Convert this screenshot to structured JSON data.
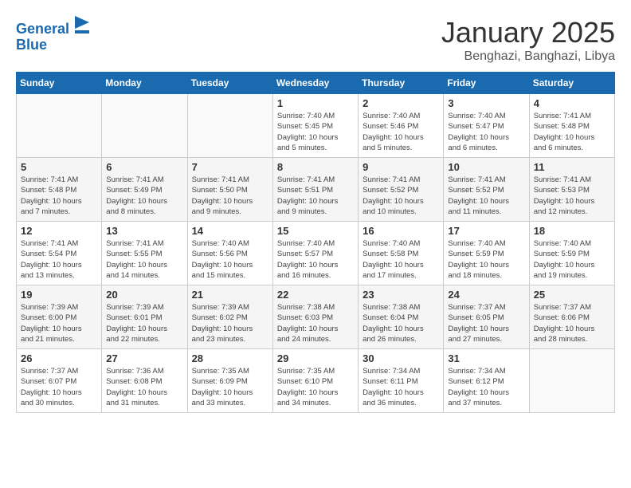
{
  "header": {
    "logo_line1": "General",
    "logo_line2": "Blue",
    "month": "January 2025",
    "location": "Benghazi, Banghazi, Libya"
  },
  "weekdays": [
    "Sunday",
    "Monday",
    "Tuesday",
    "Wednesday",
    "Thursday",
    "Friday",
    "Saturday"
  ],
  "weeks": [
    [
      {
        "day": "",
        "info": ""
      },
      {
        "day": "",
        "info": ""
      },
      {
        "day": "",
        "info": ""
      },
      {
        "day": "1",
        "info": "Sunrise: 7:40 AM\nSunset: 5:45 PM\nDaylight: 10 hours\nand 5 minutes."
      },
      {
        "day": "2",
        "info": "Sunrise: 7:40 AM\nSunset: 5:46 PM\nDaylight: 10 hours\nand 5 minutes."
      },
      {
        "day": "3",
        "info": "Sunrise: 7:40 AM\nSunset: 5:47 PM\nDaylight: 10 hours\nand 6 minutes."
      },
      {
        "day": "4",
        "info": "Sunrise: 7:41 AM\nSunset: 5:48 PM\nDaylight: 10 hours\nand 6 minutes."
      }
    ],
    [
      {
        "day": "5",
        "info": "Sunrise: 7:41 AM\nSunset: 5:48 PM\nDaylight: 10 hours\nand 7 minutes."
      },
      {
        "day": "6",
        "info": "Sunrise: 7:41 AM\nSunset: 5:49 PM\nDaylight: 10 hours\nand 8 minutes."
      },
      {
        "day": "7",
        "info": "Sunrise: 7:41 AM\nSunset: 5:50 PM\nDaylight: 10 hours\nand 9 minutes."
      },
      {
        "day": "8",
        "info": "Sunrise: 7:41 AM\nSunset: 5:51 PM\nDaylight: 10 hours\nand 9 minutes."
      },
      {
        "day": "9",
        "info": "Sunrise: 7:41 AM\nSunset: 5:52 PM\nDaylight: 10 hours\nand 10 minutes."
      },
      {
        "day": "10",
        "info": "Sunrise: 7:41 AM\nSunset: 5:52 PM\nDaylight: 10 hours\nand 11 minutes."
      },
      {
        "day": "11",
        "info": "Sunrise: 7:41 AM\nSunset: 5:53 PM\nDaylight: 10 hours\nand 12 minutes."
      }
    ],
    [
      {
        "day": "12",
        "info": "Sunrise: 7:41 AM\nSunset: 5:54 PM\nDaylight: 10 hours\nand 13 minutes."
      },
      {
        "day": "13",
        "info": "Sunrise: 7:41 AM\nSunset: 5:55 PM\nDaylight: 10 hours\nand 14 minutes."
      },
      {
        "day": "14",
        "info": "Sunrise: 7:40 AM\nSunset: 5:56 PM\nDaylight: 10 hours\nand 15 minutes."
      },
      {
        "day": "15",
        "info": "Sunrise: 7:40 AM\nSunset: 5:57 PM\nDaylight: 10 hours\nand 16 minutes."
      },
      {
        "day": "16",
        "info": "Sunrise: 7:40 AM\nSunset: 5:58 PM\nDaylight: 10 hours\nand 17 minutes."
      },
      {
        "day": "17",
        "info": "Sunrise: 7:40 AM\nSunset: 5:59 PM\nDaylight: 10 hours\nand 18 minutes."
      },
      {
        "day": "18",
        "info": "Sunrise: 7:40 AM\nSunset: 5:59 PM\nDaylight: 10 hours\nand 19 minutes."
      }
    ],
    [
      {
        "day": "19",
        "info": "Sunrise: 7:39 AM\nSunset: 6:00 PM\nDaylight: 10 hours\nand 21 minutes."
      },
      {
        "day": "20",
        "info": "Sunrise: 7:39 AM\nSunset: 6:01 PM\nDaylight: 10 hours\nand 22 minutes."
      },
      {
        "day": "21",
        "info": "Sunrise: 7:39 AM\nSunset: 6:02 PM\nDaylight: 10 hours\nand 23 minutes."
      },
      {
        "day": "22",
        "info": "Sunrise: 7:38 AM\nSunset: 6:03 PM\nDaylight: 10 hours\nand 24 minutes."
      },
      {
        "day": "23",
        "info": "Sunrise: 7:38 AM\nSunset: 6:04 PM\nDaylight: 10 hours\nand 26 minutes."
      },
      {
        "day": "24",
        "info": "Sunrise: 7:37 AM\nSunset: 6:05 PM\nDaylight: 10 hours\nand 27 minutes."
      },
      {
        "day": "25",
        "info": "Sunrise: 7:37 AM\nSunset: 6:06 PM\nDaylight: 10 hours\nand 28 minutes."
      }
    ],
    [
      {
        "day": "26",
        "info": "Sunrise: 7:37 AM\nSunset: 6:07 PM\nDaylight: 10 hours\nand 30 minutes."
      },
      {
        "day": "27",
        "info": "Sunrise: 7:36 AM\nSunset: 6:08 PM\nDaylight: 10 hours\nand 31 minutes."
      },
      {
        "day": "28",
        "info": "Sunrise: 7:35 AM\nSunset: 6:09 PM\nDaylight: 10 hours\nand 33 minutes."
      },
      {
        "day": "29",
        "info": "Sunrise: 7:35 AM\nSunset: 6:10 PM\nDaylight: 10 hours\nand 34 minutes."
      },
      {
        "day": "30",
        "info": "Sunrise: 7:34 AM\nSunset: 6:11 PM\nDaylight: 10 hours\nand 36 minutes."
      },
      {
        "day": "31",
        "info": "Sunrise: 7:34 AM\nSunset: 6:12 PM\nDaylight: 10 hours\nand 37 minutes."
      },
      {
        "day": "",
        "info": ""
      }
    ]
  ]
}
